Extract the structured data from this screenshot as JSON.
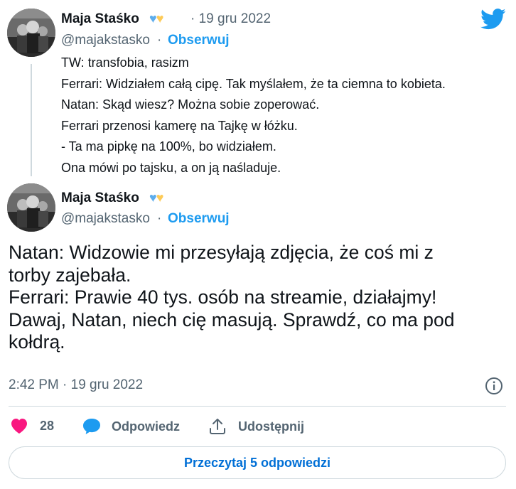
{
  "quoted_tweet": {
    "author_name": "Maja Staśko",
    "hearts": [
      "💙",
      "💛"
    ],
    "date": "· 19 gru 2022",
    "handle": "@majakstasko",
    "separator": "·",
    "follow_label": "Obserwuj",
    "lines": [
      "TW: transfobia, rasizm",
      "Ferrari: Widziałem całą cipę. Tak myślałem, że ta ciemna to kobieta.",
      "Natan: Skąd wiesz? Można sobie zoperować.",
      "Ferrari przenosi kamerę na Tajkę w łóżku.",
      "- Ta ma pipkę na 100%, bo widziałem.",
      "Ona mówi po tajsku, a on ją naśladuje."
    ]
  },
  "main_tweet": {
    "author_name": "Maja Staśko",
    "handle": "@majakstasko",
    "separator": "·",
    "follow_label": "Obserwuj",
    "lines": [
      "Natan: Widzowie mi przesyłają zdjęcia, że coś mi z",
      "torby zajebała.",
      "Ferrari: Prawie 40 tys. osób na streamie, działajmy!",
      "Dawaj, Natan, niech cię masują. Sprawdź, co ma pod",
      "kołdrą."
    ],
    "timestamp": "2:42 PM · 19 gru 2022"
  },
  "actions": {
    "like_count": "28",
    "reply_label": "Odpowiedz",
    "share_label": "Udostępnij"
  },
  "read_replies_label": "Przeczytaj 5 odpowiedzi",
  "colors": {
    "accent": "#1d9bf0",
    "like": "#f91880",
    "muted": "#536471"
  },
  "icons": [
    "twitter-bird-icon",
    "info-icon",
    "heart-icon",
    "reply-bubble-icon",
    "share-icon"
  ]
}
